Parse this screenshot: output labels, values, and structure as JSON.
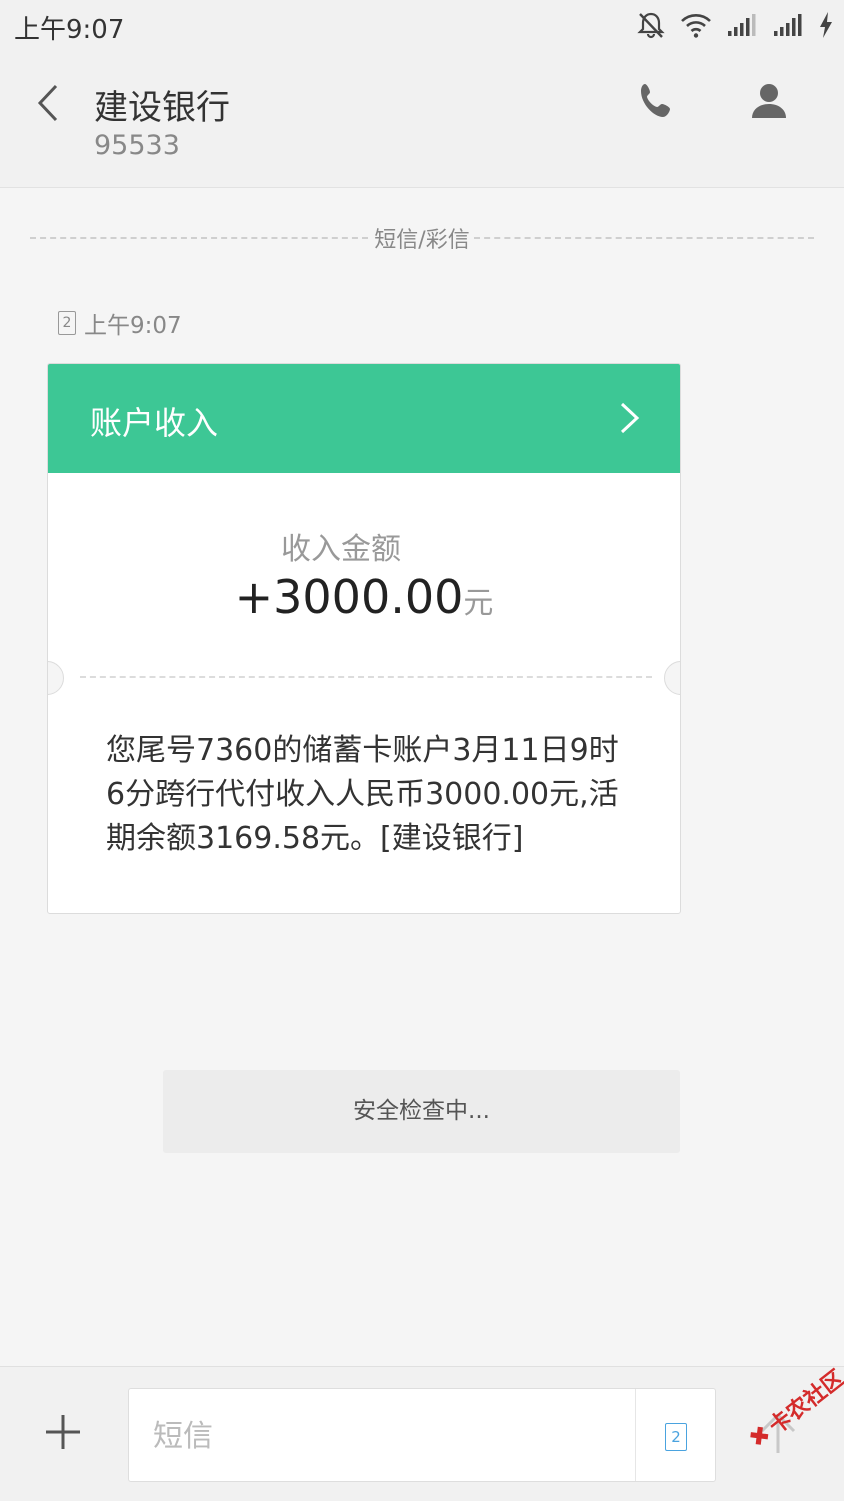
{
  "status_bar": {
    "time": "上午9:07",
    "icons": [
      "mute-icon",
      "wifi-icon",
      "signal-1-icon",
      "signal-2-icon",
      "charging-icon"
    ]
  },
  "header": {
    "contact_name": "建设银行",
    "contact_number": "95533"
  },
  "thread": {
    "separator_label": "短信/彩信",
    "message": {
      "sim_slot": "2",
      "time": "上午9:07",
      "card": {
        "title": "账户收入",
        "amount_label": "收入金额",
        "amount_value": "+3000.00",
        "amount_unit": "元",
        "body": "您尾号7360的储蓄卡账户3月11日9时6分跨行代付收入人民币3000.00元,活期余额3169.58元。[建设银行]"
      }
    },
    "security_status": "安全检查中..."
  },
  "composer": {
    "placeholder": "短信",
    "sim_slot": "2"
  },
  "watermark": {
    "text": "卡农社区"
  },
  "colors": {
    "card_header": "#3dc795",
    "progress": "#3bc18a",
    "sim_accent": "#4aa3df",
    "watermark": "#d42b2b"
  }
}
